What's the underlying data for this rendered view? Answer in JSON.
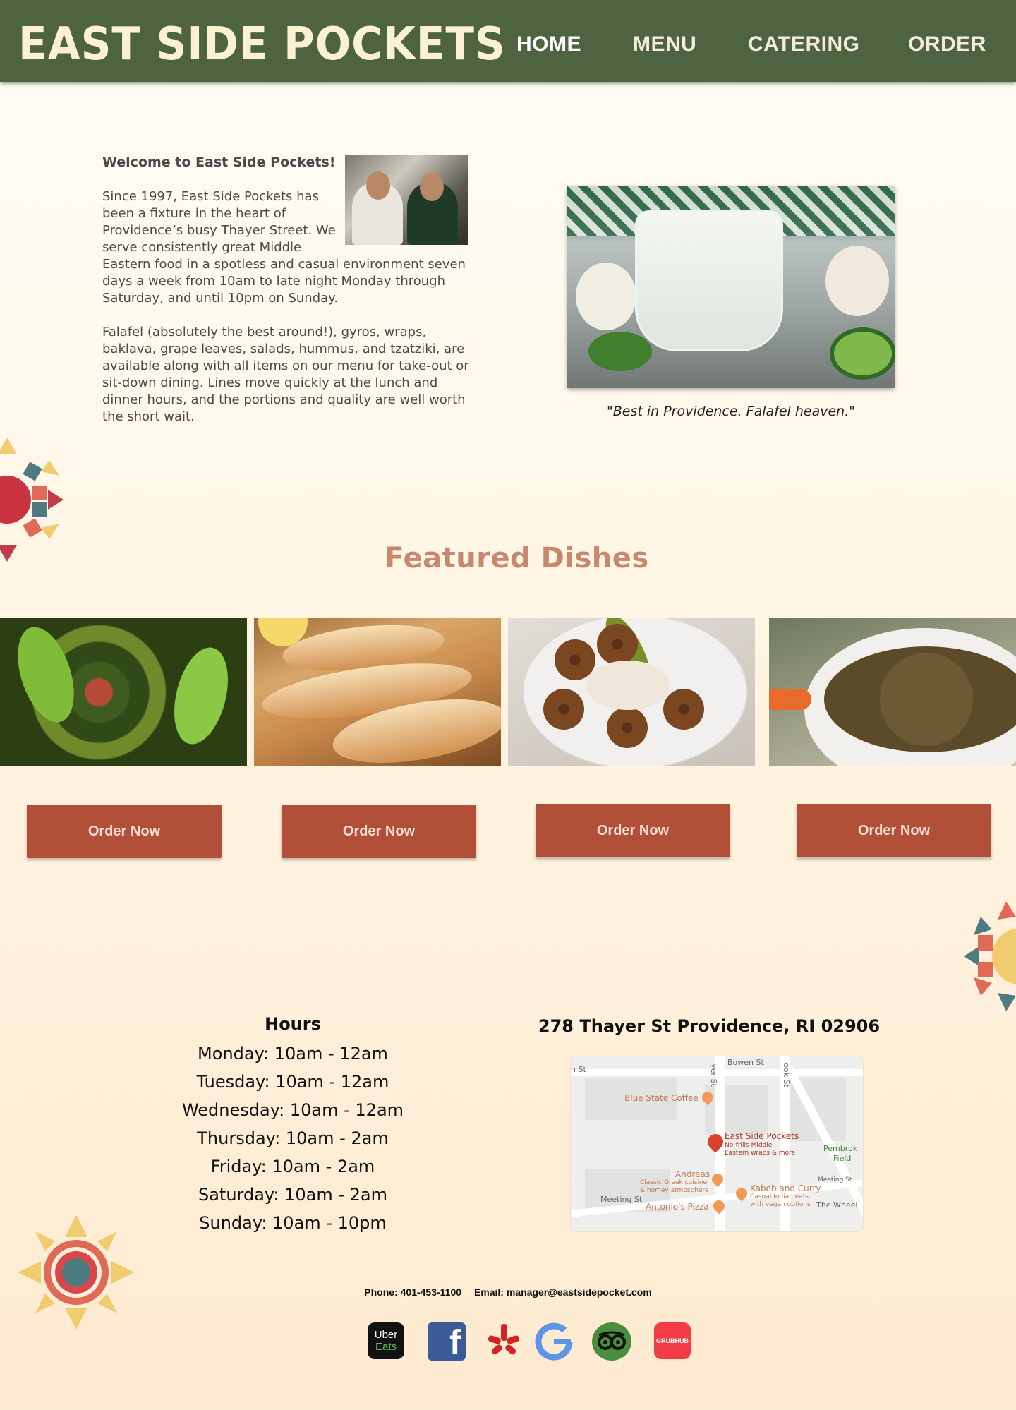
{
  "header": {
    "logo": "EAST SIDE POCKETS",
    "nav": [
      "HOME",
      "MENU",
      "CATERING",
      "ORDER"
    ]
  },
  "intro": {
    "heading": "Welcome to East Side Pockets!",
    "paragraph1": "Since 1997, East Side Pockets has been a fixture in the heart of Providence’s busy Thayer Street. We serve consistently great Middle Eastern food in a  spotless and casual environment seven days a week from 10am to late night Monday through Saturday, and until 10pm on Sunday.",
    "paragraph2": "Falafel (absolutely the best around!), gyros, wraps, baklava, grape leaves, salads, hummus, and tzatziki, are available along with all items on our menu for take-out or sit-down dining. Lines move quickly at the lunch and dinner hours, and the portions and quality are well worth the short wait.",
    "quote": "\"Best in Providence. Falafel heaven.\""
  },
  "featured": {
    "title": "Featured Dishes",
    "button_label": "Order Now",
    "buttons": [
      "Order Now",
      "Order Now",
      "Order Now",
      "Order Now"
    ]
  },
  "hours": {
    "title": "Hours",
    "lines": [
      "Monday: 10am - 12am",
      "Tuesday: 10am - 12am",
      "Wednesday: 10am - 12am",
      "Thursday: 10am - 2am",
      "Friday: 10am - 2am",
      "Saturday: 10am - 2am",
      "Sunday: 10am - 10pm"
    ]
  },
  "location": {
    "address": "278 Thayer St Providence, RI 02906",
    "map": {
      "streets": [
        "Bowen St",
        "yer St",
        "ook St",
        "Meeting St",
        "n St"
      ],
      "pois": {
        "blue_state": "Blue State Coffee",
        "esp_name": "East Side Pockets",
        "esp_desc1": "No-frills Middle",
        "esp_desc2": "Eastern wraps & more",
        "pembroke1": "Pembrok",
        "pembroke2": "Field",
        "andreas": "Andreas",
        "andreas_desc1": "Classic Greek cuisine",
        "andreas_desc2": "& homey atmosphere",
        "kabob": "Kabob and Curry",
        "kabob_desc1": "Casual Indian eats",
        "kabob_desc2": "with vegan options",
        "antonios": "Antonio's Pizza",
        "wheel": "The Wheel"
      }
    }
  },
  "contact": {
    "phone": "Phone: 401-453-1100",
    "email": "Email: manager@eastsidepocket.com"
  },
  "social": {
    "uber_line1": "Uber",
    "uber_line2": "Eats",
    "facebook": "f",
    "grubhub": "GRUBHUB"
  },
  "colors": {
    "header_bg": "#4e6440",
    "logo": "#fdf1d4",
    "featured_title": "#c9876d",
    "button_bg": "#b14f38"
  }
}
